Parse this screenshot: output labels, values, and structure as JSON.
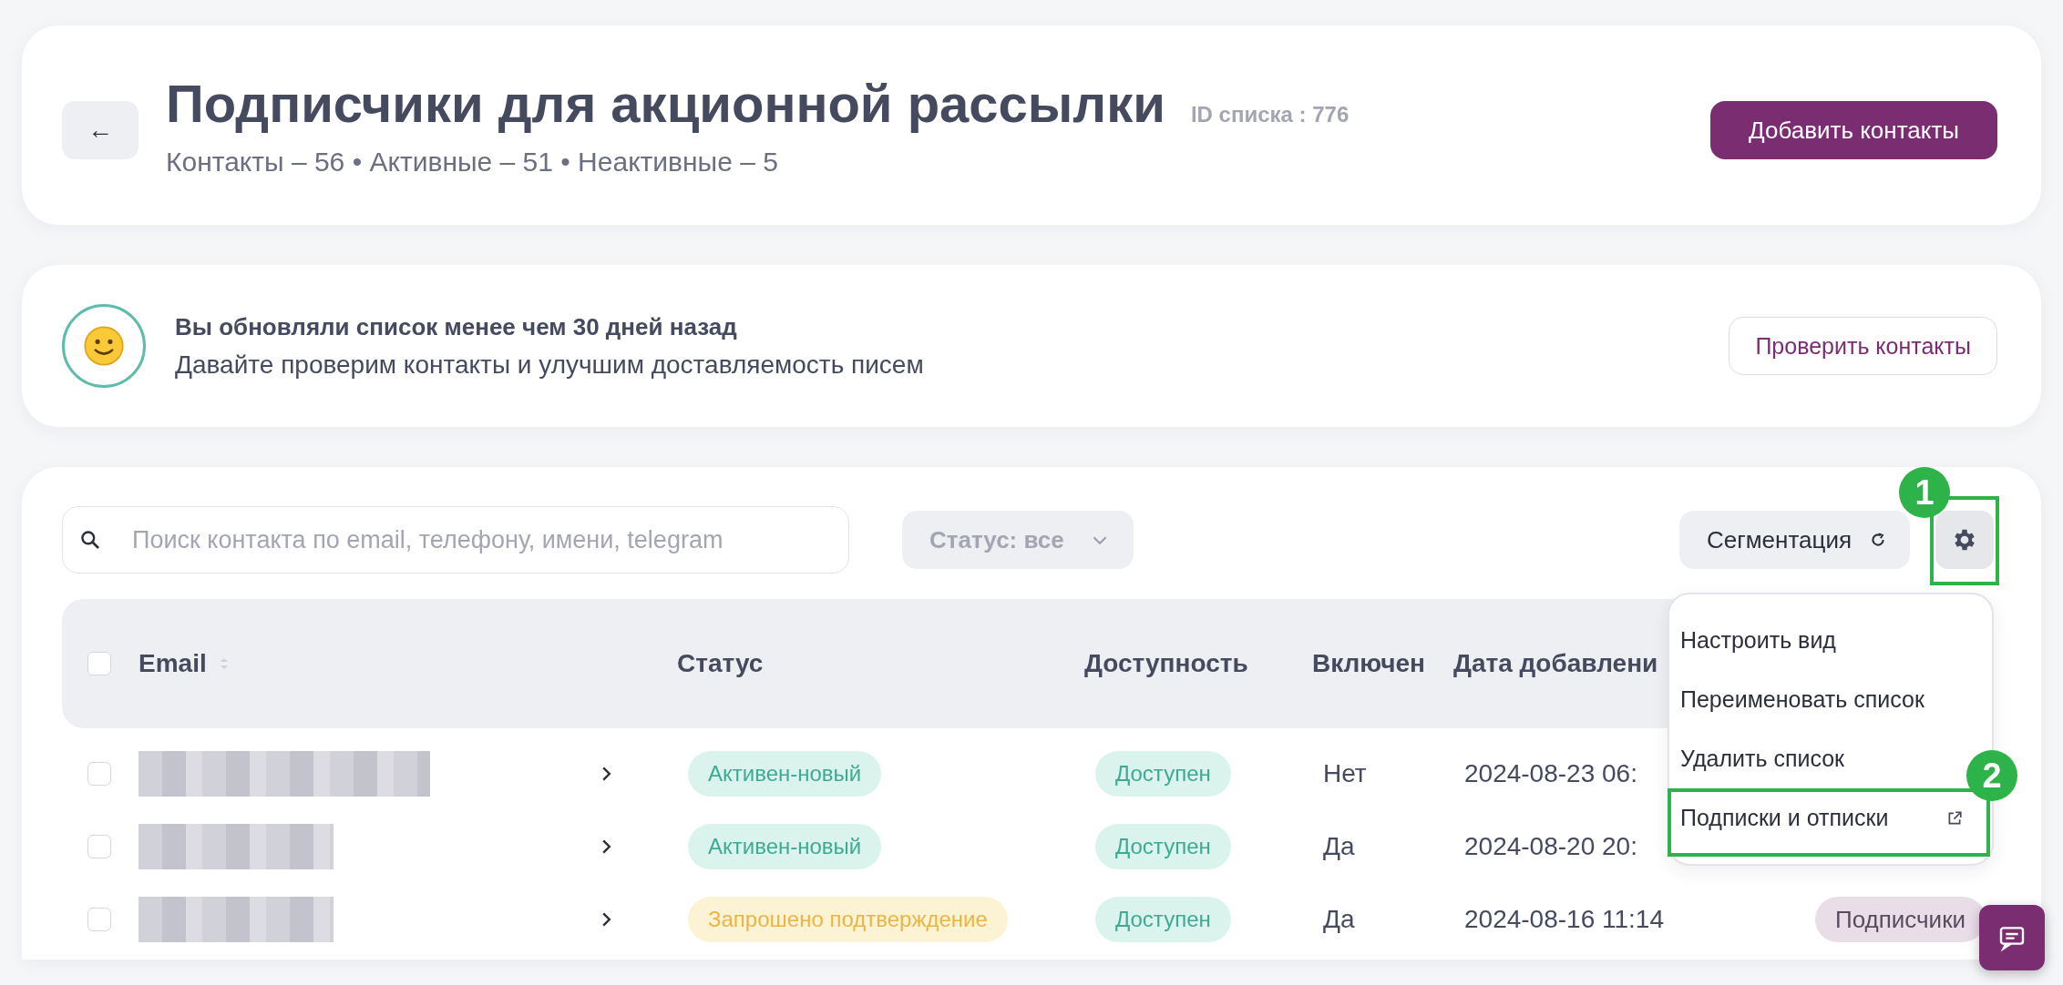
{
  "header": {
    "back_button": "←",
    "title": "Подписчики для акционной рассылки",
    "list_id": "ID списка : 776",
    "stats": "Контакты – 56 • Активные – 51 • Неактивные – 5",
    "add_button": "Добавить контакты"
  },
  "notice": {
    "title": "Вы обновляли список менее чем 30 дней назад",
    "text": "Давайте проверим контакты и улучшим доставляемость писем",
    "button": "Проверить контакты"
  },
  "toolbar": {
    "search": {
      "placeholder": "Поиск контакта по email, телефону, имени, telegram"
    },
    "status_filter": "Статус: все",
    "segmentation_button": "Сегментация",
    "settings_button": {
      "callout": "1"
    }
  },
  "table": {
    "header_checked": false,
    "columns": [
      {
        "label": "Email",
        "sortable": true
      },
      {
        "label": "Статус",
        "sortable": false
      },
      {
        "label": "Доступность",
        "sortable": false
      },
      {
        "label": "Включен",
        "sortable": false
      },
      {
        "label": "Дата добавлени",
        "sortable": false
      }
    ],
    "rows": [
      {
        "checked": false,
        "status": {
          "label": "Активен-новый",
          "kind": "active"
        },
        "availability": "Доступен",
        "included": "Нет",
        "date": "2024-08-23 06:"
      },
      {
        "checked": false,
        "status": {
          "label": "Активен-новый",
          "kind": "active"
        },
        "availability": "Доступен",
        "included": "Да",
        "date": "2024-08-20 20:"
      },
      {
        "checked": false,
        "status": {
          "label": "Запрошено подтверждение",
          "kind": "pending"
        },
        "availability": "Доступен",
        "included": "Да",
        "date": "2024-08-16 11:14",
        "column_6": "Подписчики"
      }
    ]
  },
  "settings_menu": {
    "items": [
      {
        "label": "Настроить вид",
        "external": false
      },
      {
        "label": "Переименовать список",
        "external": false
      },
      {
        "label": "Удалить список",
        "external": false
      },
      {
        "label": "Подписки и отписки",
        "external": true,
        "callout": "2"
      }
    ]
  }
}
